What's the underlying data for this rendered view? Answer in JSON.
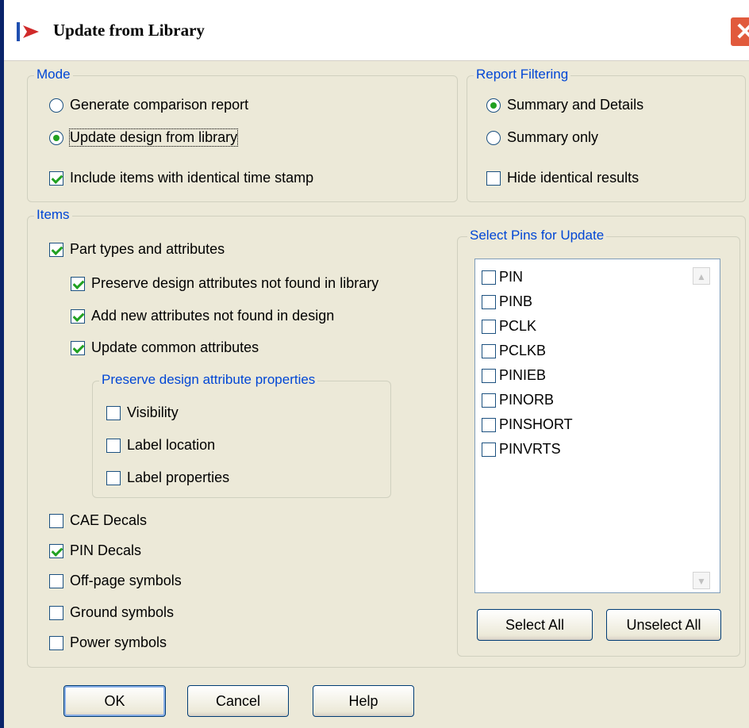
{
  "window": {
    "title": "Update from Library",
    "close_glyph": "✕"
  },
  "mode": {
    "legend": "Mode",
    "generate_report": "Generate comparison report",
    "update_design": "Update design from library",
    "include_identical": "Include items with identical time stamp",
    "selected": "update_design",
    "include_identical_checked": true
  },
  "report_filtering": {
    "legend": "Report Filtering",
    "summary_details": "Summary and Details",
    "summary_only": "Summary only",
    "hide_identical": "Hide identical results",
    "selected": "summary_details",
    "hide_identical_checked": false
  },
  "items": {
    "legend": "Items",
    "part_types": {
      "label": "Part types and attributes",
      "checked": true
    },
    "preserve_not_found": {
      "label": "Preserve design attributes not found in library",
      "checked": true
    },
    "add_new": {
      "label": "Add new attributes not found in design",
      "checked": true
    },
    "update_common": {
      "label": "Update common attributes",
      "checked": true
    },
    "preserve_props": {
      "legend": "Preserve design attribute properties",
      "visibility": {
        "label": "Visibility",
        "checked": false
      },
      "label_location": {
        "label": "Label location",
        "checked": false
      },
      "label_properties": {
        "label": "Label properties",
        "checked": false
      }
    },
    "cae_decals": {
      "label": "CAE Decals",
      "checked": false
    },
    "pin_decals": {
      "label": "PIN Decals",
      "checked": true
    },
    "offpage_symbols": {
      "label": "Off-page symbols",
      "checked": false
    },
    "ground_symbols": {
      "label": "Ground symbols",
      "checked": false
    },
    "power_symbols": {
      "label": "Power symbols",
      "checked": false
    }
  },
  "pins": {
    "legend": "Select Pins for Update",
    "list": [
      {
        "label": "PIN",
        "checked": false
      },
      {
        "label": "PINB",
        "checked": false
      },
      {
        "label": "PCLK",
        "checked": false
      },
      {
        "label": "PCLKB",
        "checked": false
      },
      {
        "label": "PINIEB",
        "checked": false
      },
      {
        "label": "PINORB",
        "checked": false
      },
      {
        "label": "PINSHORT",
        "checked": false
      },
      {
        "label": "PINVRTS",
        "checked": false
      }
    ],
    "select_all": "Select All",
    "unselect_all": "Unselect All"
  },
  "buttons": {
    "ok": "OK",
    "cancel": "Cancel",
    "help": "Help"
  },
  "icons": {
    "title": "app-arrow-icon",
    "close": "close-icon",
    "scroll_up": "scroll-up-icon",
    "scroll_down": "scroll-down-icon"
  },
  "colors": {
    "accent": "#0046d5",
    "check": "#21a121",
    "close": "#e15a3c",
    "titlebar_edge": "#0a246a"
  }
}
